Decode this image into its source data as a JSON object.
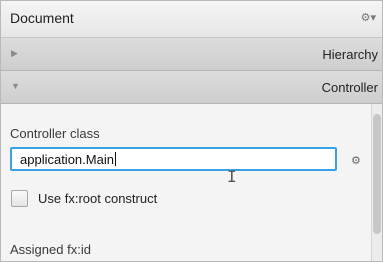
{
  "panel": {
    "title": "Document",
    "menu_icon": "⚙▾"
  },
  "sections": {
    "hierarchy": {
      "label": "Hierarchy",
      "arrow": "▶"
    },
    "controller": {
      "label": "Controller",
      "arrow": "▼"
    }
  },
  "controller": {
    "class_label": "Controller class",
    "class_value": "application.Main",
    "field_gear_icon": "⚙",
    "fxroot_label": "Use fx:root construct",
    "fxroot_checked": false,
    "assigned_fxid_label": "Assigned fx:id"
  },
  "colors": {
    "focus_border": "#39a2e6",
    "section_bg": "#d6d6d6"
  }
}
